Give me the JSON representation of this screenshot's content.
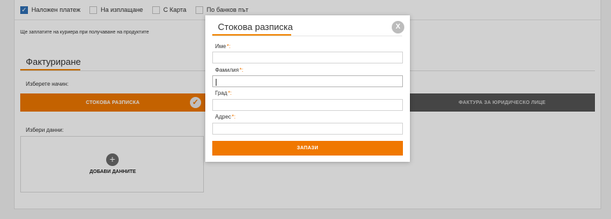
{
  "payment": {
    "options": [
      {
        "label": "Наложен платеж",
        "checked": true
      },
      {
        "label": "На изплащане",
        "checked": false
      },
      {
        "label": "С Карта",
        "checked": false
      },
      {
        "label": "По банков път",
        "checked": false
      }
    ],
    "courier_note": "Ще заплатите на куриера при получаване на продуктите"
  },
  "billing": {
    "title": "Фактуриране",
    "choose_label": "Изберете начин:",
    "receipt_label": "Стокова разписка",
    "invoice_label": "Фактура за юридическо лице",
    "select_data_label": "Избери данни:",
    "add_data_label": "Добави данните"
  },
  "modal": {
    "title": "Стокова разписка",
    "close_label": "X",
    "fields": [
      {
        "label": "Име",
        "required_mark": "*:",
        "value": ""
      },
      {
        "label": "Фамилия",
        "required_mark": "*:",
        "value": ""
      },
      {
        "label": "Град",
        "required_mark": "*:",
        "value": ""
      },
      {
        "label": "Адрес",
        "required_mark": "*:",
        "value": ""
      }
    ],
    "save_label": "Запази"
  },
  "colors": {
    "accent": "#f07800",
    "checkbox_checked": "#2f6fb5",
    "invoice_button": "#555555"
  },
  "icons": {
    "selected_check": "check-icon",
    "add_data": "plus-icon",
    "close": "close-icon"
  }
}
